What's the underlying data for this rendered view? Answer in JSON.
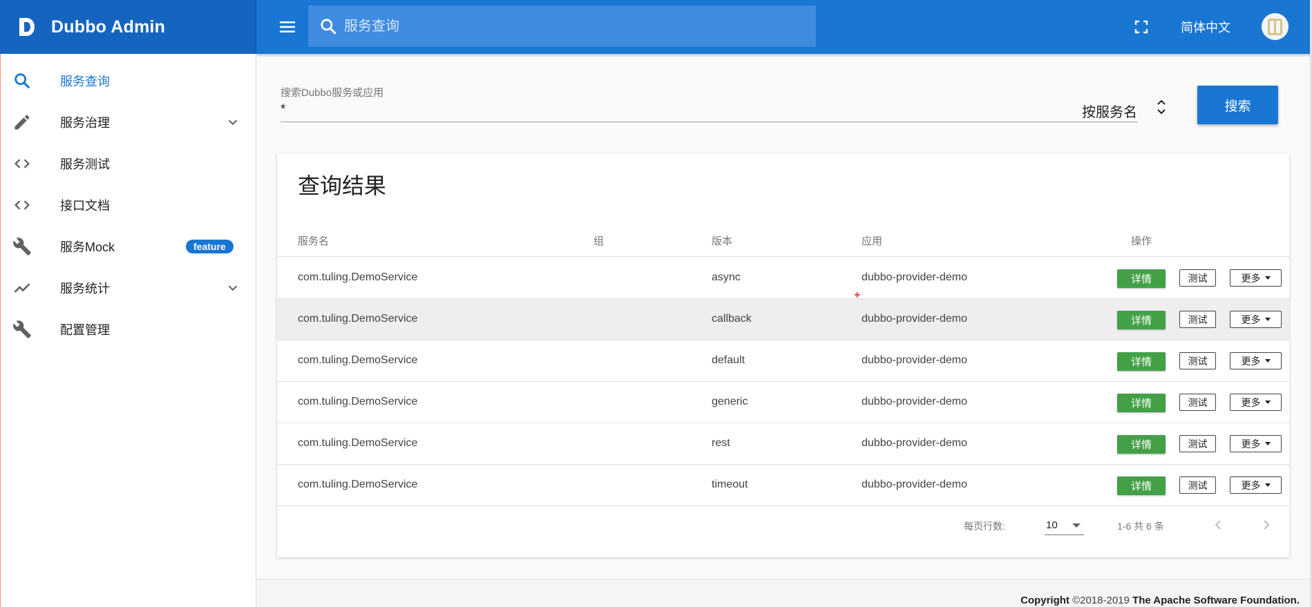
{
  "app": {
    "name": "Dubbo Admin",
    "brand_color": "#1565c0",
    "toolbar_color": "#1976d2",
    "logo_icon": "dubbo-logo-icon"
  },
  "topbar": {
    "search_placeholder": "服务查询",
    "language": "简体中文",
    "fullscreen_icon": "fullscreen-icon",
    "menu_icon": "menu-icon"
  },
  "sidebar": {
    "items": [
      {
        "label": "服务查询",
        "icon": "search-icon",
        "active": true
      },
      {
        "label": "服务治理",
        "icon": "pencil-icon",
        "expandable": true
      },
      {
        "label": "服务测试",
        "icon": "code-icon"
      },
      {
        "label": "接口文档",
        "icon": "code-icon"
      },
      {
        "label": "服务Mock",
        "icon": "wrench-icon",
        "badge": "feature"
      },
      {
        "label": "服务统计",
        "icon": "chart-line-icon",
        "expandable": true
      },
      {
        "label": "配置管理",
        "icon": "wrench-icon"
      }
    ]
  },
  "search": {
    "field_label": "搜索Dubbo服务或应用",
    "field_value": "*",
    "type_value": "按服务名",
    "submit_label": "搜索"
  },
  "results": {
    "title": "查询结果",
    "columns": [
      "服务名",
      "组",
      "版本",
      "应用",
      "操作"
    ],
    "rows": [
      {
        "service": "com.tuling.DemoService",
        "group": "",
        "version": "async",
        "app": "dubbo-provider-demo"
      },
      {
        "service": "com.tuling.DemoService",
        "group": "",
        "version": "callback",
        "app": "dubbo-provider-demo"
      },
      {
        "service": "com.tuling.DemoService",
        "group": "",
        "version": "default",
        "app": "dubbo-provider-demo"
      },
      {
        "service": "com.tuling.DemoService",
        "group": "",
        "version": "generic",
        "app": "dubbo-provider-demo"
      },
      {
        "service": "com.tuling.DemoService",
        "group": "",
        "version": "rest",
        "app": "dubbo-provider-demo"
      },
      {
        "service": "com.tuling.DemoService",
        "group": "",
        "version": "timeout",
        "app": "dubbo-provider-demo"
      }
    ],
    "actions": {
      "detail": "详情",
      "test": "测试",
      "more": "更多"
    },
    "detail_color": "#43a047"
  },
  "pagination": {
    "rows_per_page_label": "每页行数:",
    "rows_per_page_value": "10",
    "range_text": "1-6 共 6 条"
  },
  "footer": {
    "copyright": "Copyright",
    "years": "©2018-2019",
    "org": "The Apache Software Foundation."
  }
}
